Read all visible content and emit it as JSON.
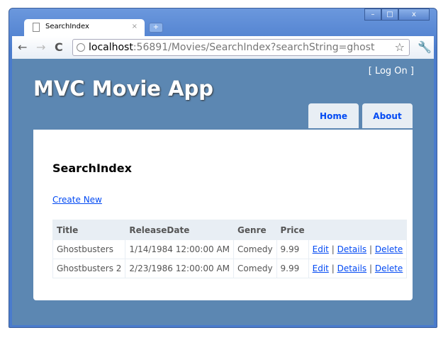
{
  "browser": {
    "tab_title": "SearchIndex",
    "url_host": "localhost",
    "url_rest": ":56891/Movies/SearchIndex?searchString=ghost",
    "controls": {
      "min": "–",
      "max": "□",
      "close": "x"
    },
    "new_tab": "+"
  },
  "header": {
    "logon_open": "[ ",
    "logon_label": "Log On",
    "logon_close": " ]",
    "title": "MVC Movie App"
  },
  "menu": [
    {
      "label": "Home"
    },
    {
      "label": "About"
    }
  ],
  "main": {
    "heading": "SearchIndex",
    "create_label": "Create New",
    "columns": [
      "Title",
      "ReleaseDate",
      "Genre",
      "Price"
    ],
    "rows": [
      {
        "title": "Ghostbusters",
        "date": "1/14/1984 12:00:00 AM",
        "genre": "Comedy",
        "price": "9.99"
      },
      {
        "title": "Ghostbusters 2",
        "date": "2/23/1986 12:00:00 AM",
        "genre": "Comedy",
        "price": "9.99"
      }
    ],
    "actions": {
      "edit": "Edit",
      "details": "Details",
      "delete": "Delete",
      "sep": "|"
    }
  }
}
